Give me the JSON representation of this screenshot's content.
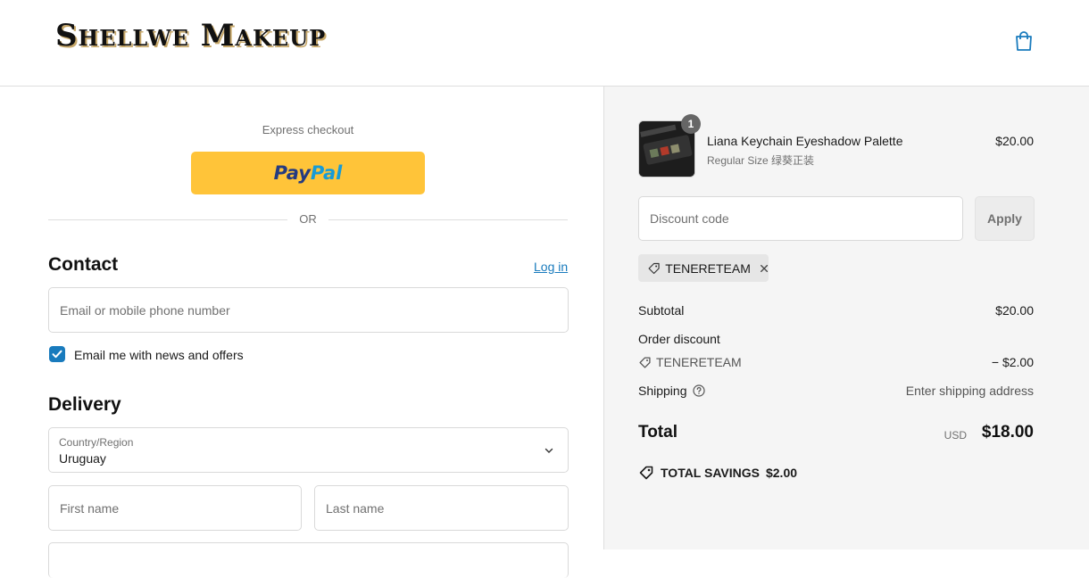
{
  "header": {
    "logo_text": "Shellwe Makeup",
    "cart_icon": "shopping-bag-icon"
  },
  "express": {
    "label": "Express checkout",
    "paypal_pay": "Pay",
    "paypal_pal": "Pal",
    "or": "OR"
  },
  "contact": {
    "heading": "Contact",
    "login_link": "Log in",
    "email_placeholder": "Email or mobile phone number",
    "newsletter_label": "Email me with news and offers",
    "newsletter_checked": true
  },
  "delivery": {
    "heading": "Delivery",
    "country_label": "Country/Region",
    "country_value": "Uruguay",
    "first_name_placeholder": "First name",
    "last_name_placeholder": "Last name"
  },
  "summary": {
    "product": {
      "name": "Liana Keychain Eyeshadow Palette",
      "variant": "Regular Size 绿葵正装",
      "price": "$20.00",
      "quantity": "1"
    },
    "discount_placeholder": "Discount code",
    "apply_label": "Apply",
    "applied_code": "TENERETEAM",
    "subtotal_label": "Subtotal",
    "subtotal_value": "$20.00",
    "order_discount_label": "Order discount",
    "order_discount_code": "TENERETEAM",
    "order_discount_value": "− $2.00",
    "shipping_label": "Shipping",
    "shipping_value": "Enter shipping address",
    "total_label": "Total",
    "total_currency": "USD",
    "total_value": "$18.00",
    "savings_label": "TOTAL SAVINGS",
    "savings_value": "$2.00"
  },
  "colors": {
    "accent": "#197bbd",
    "paypal_yellow": "#ffc439",
    "summary_bg": "#f5f5f5"
  }
}
